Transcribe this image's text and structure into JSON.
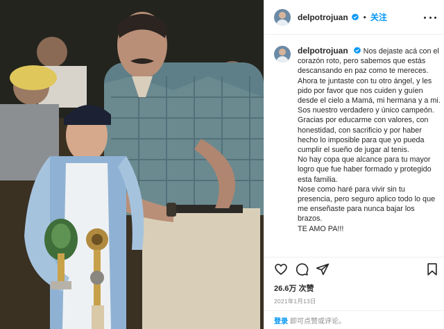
{
  "post": {
    "username": "delpotrojuan",
    "follow_label": "关注",
    "separator": "•",
    "caption_lines": [
      "Nos dejaste acá con el corazón roto, pero sabemos que estás descansando en paz como te mereces. Ahora te juntaste con tu otro ángel, y les pido por favor que nos cuiden y guíen desde el cielo a Mamá, mi hermana y a mi.",
      "Sos nuestro verdadero y único campeón. Gracias por educarme con valores, con honestidad, con sacrificio y por haber hecho lo imposible para que yo pueda cumplir el sueño de jugar al tenis.",
      "No hay copa que alcance para tu mayor logro que fue haber formado y protegido esta familia.",
      "Nose como haré para vivir sin tu presencia, pero seguro aplico todo lo que me enseñaste para nunca bajar los brazos.",
      "TE AMO PA!!!"
    ],
    "likes": "26.6万 次赞",
    "date": "2021年1月13日"
  },
  "login": {
    "link": "登录",
    "rest": "即可点赞或评论。"
  },
  "icons": {
    "verified": "verified-badge-icon",
    "more": "more-options-icon",
    "like": "heart-icon",
    "comment": "comment-icon",
    "share": "paper-plane-icon",
    "save": "bookmark-icon"
  },
  "colors": {
    "accent": "#0095f6",
    "text": "#262626",
    "muted": "#8e8e8e"
  }
}
